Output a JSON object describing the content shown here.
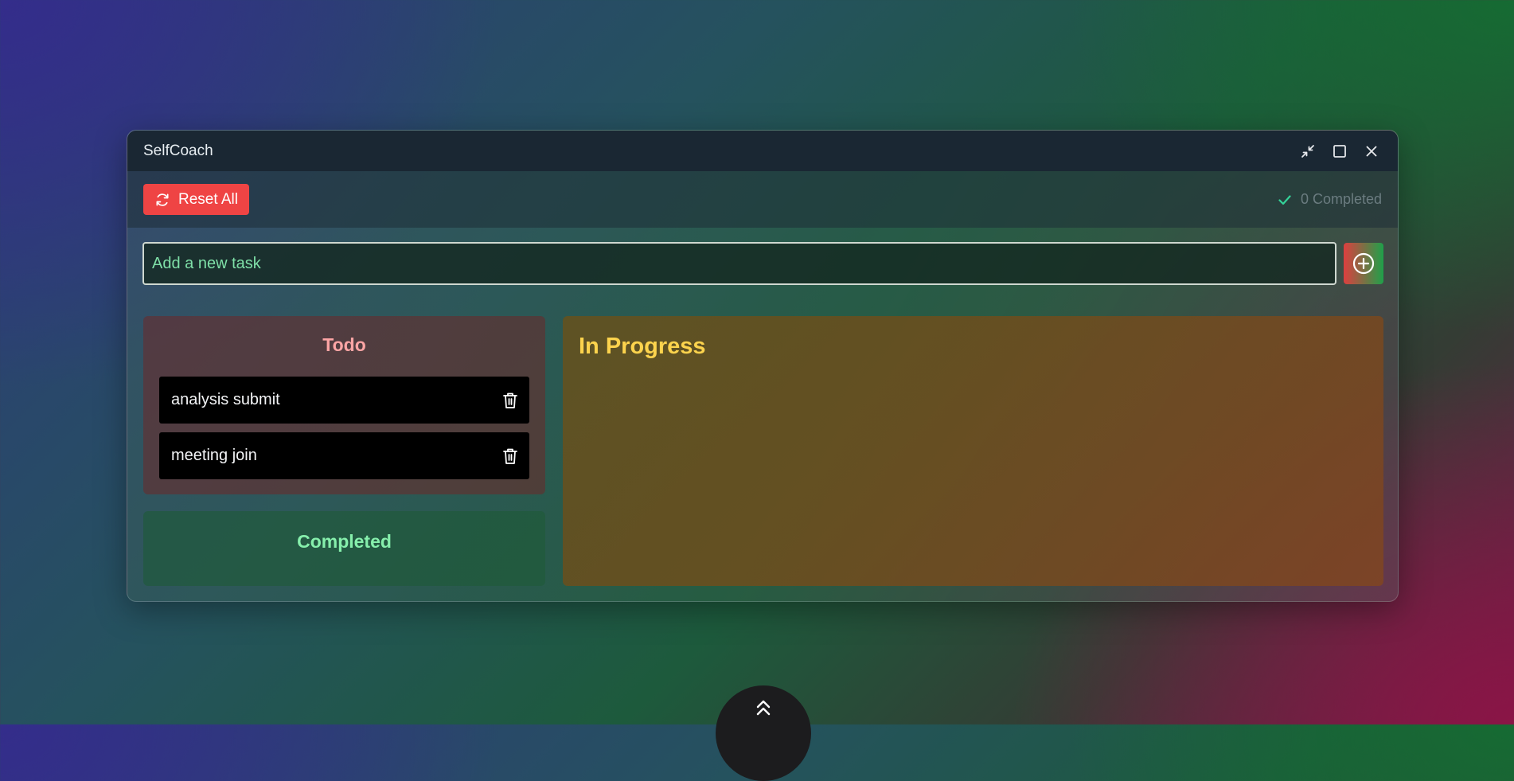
{
  "window": {
    "title": "SelfCoach",
    "controls": [
      "collapse-icon",
      "maximize-icon",
      "close-icon"
    ]
  },
  "toolbar": {
    "reset_label": "Reset All",
    "reset_icon": "refresh-icon",
    "completed_text": "0 Completed",
    "completed_icon": "check-icon"
  },
  "new_task": {
    "placeholder": "Add a new task",
    "value": "",
    "add_icon": "plus-circle-icon"
  },
  "columns": {
    "todo": {
      "title": "Todo",
      "tasks": [
        {
          "label": "analysis submit",
          "icon": "trash-icon"
        },
        {
          "label": "meeting join",
          "icon": "trash-icon"
        }
      ]
    },
    "completed": {
      "title": "Completed"
    },
    "in_progress": {
      "title": "In Progress"
    }
  },
  "scroll_button": {
    "icon": "double-chevron-up-icon"
  },
  "colors": {
    "reset": "#ef4444",
    "todo_title": "#fca5a5",
    "completed_title": "#86efac",
    "progress_title": "#fcd34d",
    "placeholder": "#7fe0a8",
    "check": "#34d399"
  }
}
